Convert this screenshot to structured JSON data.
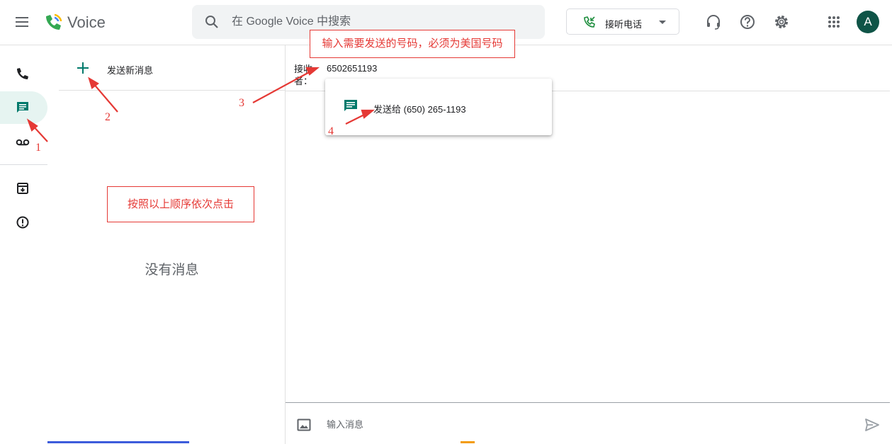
{
  "header": {
    "app_name": "Voice",
    "search_placeholder": "在 Google Voice 中搜索",
    "call_button_label": "接听电话",
    "avatar_initial": "A"
  },
  "nav": {
    "items": [
      {
        "id": "calls",
        "icon": "phone-icon"
      },
      {
        "id": "messages",
        "icon": "message-icon",
        "active": true
      },
      {
        "id": "voicemail",
        "icon": "voicemail-icon"
      },
      {
        "id": "archive",
        "icon": "archive-icon"
      },
      {
        "id": "spam",
        "icon": "spam-icon"
      }
    ]
  },
  "conversation_list": {
    "new_message_label": "发送新消息",
    "empty_text": "没有消息"
  },
  "compose": {
    "recipient_label": "接收者：",
    "recipient_value": "6502651193",
    "suggestion_label": "发送给 (650) 265-1193",
    "message_placeholder": "输入消息"
  },
  "annotations": {
    "box_top": "输入需要发送的号码，必须为美国号码",
    "box_left": "按照以上顺序依次点击",
    "step1": "1",
    "step2": "2",
    "step3": "3",
    "step4": "4"
  },
  "colors": {
    "accent": "#00796b",
    "annotation_red": "#e53935",
    "avatar_bg": "#0f5447"
  }
}
